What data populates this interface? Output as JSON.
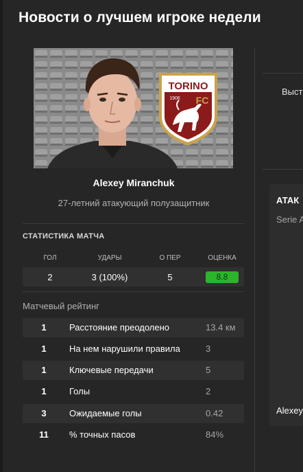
{
  "header": {
    "title": "Новости о лучшем игроке недели"
  },
  "player": {
    "name": "Alexey Miranchuk",
    "description": "27-летний атакующий полузащитник",
    "club_logo": {
      "name": "torino-fc-crest",
      "text_top": "TORINO",
      "year": "1906",
      "text_fc": "FC",
      "colors": [
        "#8b1a1a",
        "#ffffff",
        "#c9a24a"
      ]
    }
  },
  "match_stats": {
    "title": "СТАТИСТИКА МАТЧА",
    "columns": [
      {
        "label": "ГОЛ",
        "value": "2"
      },
      {
        "label": "УДАРЫ",
        "value": "3 (100%)"
      },
      {
        "label": "О ПЕР",
        "value": "5"
      },
      {
        "label": "ОЦЕНКА",
        "value": "8.8"
      }
    ],
    "rating_color": "#2cb52c"
  },
  "match_rating": {
    "title": "Матчевый рейтинг",
    "rows": [
      {
        "rank": "1",
        "label": "Расстояние преодолено",
        "value": "13.4 км"
      },
      {
        "rank": "1",
        "label": "На нем нарушили правила",
        "value": "3"
      },
      {
        "rank": "1",
        "label": "Ключевые передачи",
        "value": "5"
      },
      {
        "rank": "1",
        "label": "Голы",
        "value": "2"
      },
      {
        "rank": "3",
        "label": "Ожидаемые голы",
        "value": "0.42"
      },
      {
        "rank": "11",
        "label": "% точных пасов",
        "value": "84%"
      }
    ]
  },
  "right_panel": {
    "partial_label_1": "Выст",
    "card_title": "АТАК",
    "card_subtitle": "Serie A",
    "card_footer": "Alexey"
  }
}
